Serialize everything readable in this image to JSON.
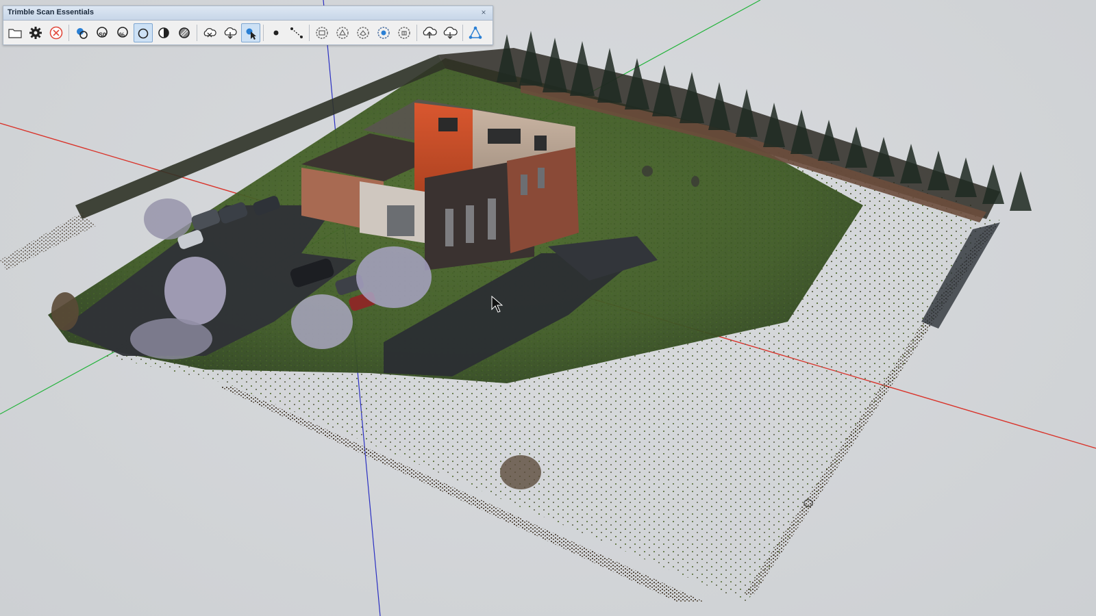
{
  "toolbar": {
    "title": "Trimble Scan Essentials",
    "close_glyph": "×",
    "buttons": [
      {
        "icon": "open-folder-icon"
      },
      {
        "icon": "settings-gear-icon"
      },
      {
        "icon": "cancel-circle-icon"
      },
      {
        "icon": "point-cloud-manager-icon"
      },
      {
        "icon": "scan-stations-icon"
      },
      {
        "icon": "region-scan-icon"
      },
      {
        "icon": "hollow-circle-icon",
        "active": true
      },
      {
        "icon": "half-circle-icon"
      },
      {
        "icon": "hatched-circle-icon"
      },
      {
        "icon": "cloud-hide-icon"
      },
      {
        "icon": "cloud-download-icon"
      },
      {
        "icon": "cloud-select-icon",
        "active": true
      },
      {
        "icon": "point-snap-icon"
      },
      {
        "icon": "line-snap-icon"
      },
      {
        "icon": "gear-plane-icon"
      },
      {
        "icon": "gear-edge-icon"
      },
      {
        "icon": "gear-cylinder-icon"
      },
      {
        "icon": "gear-sphere-icon"
      },
      {
        "icon": "gear-box-icon"
      },
      {
        "icon": "cloud-export-icon"
      },
      {
        "icon": "cloud-import-icon"
      },
      {
        "icon": "triangle-mesh-icon"
      }
    ]
  },
  "colors": {
    "axis_red": "#d9342b",
    "axis_green": "#22b33a",
    "axis_blue": "#2a2fc2",
    "accent_blue": "#2a7fd4",
    "cancel_red": "#e14a3d"
  }
}
